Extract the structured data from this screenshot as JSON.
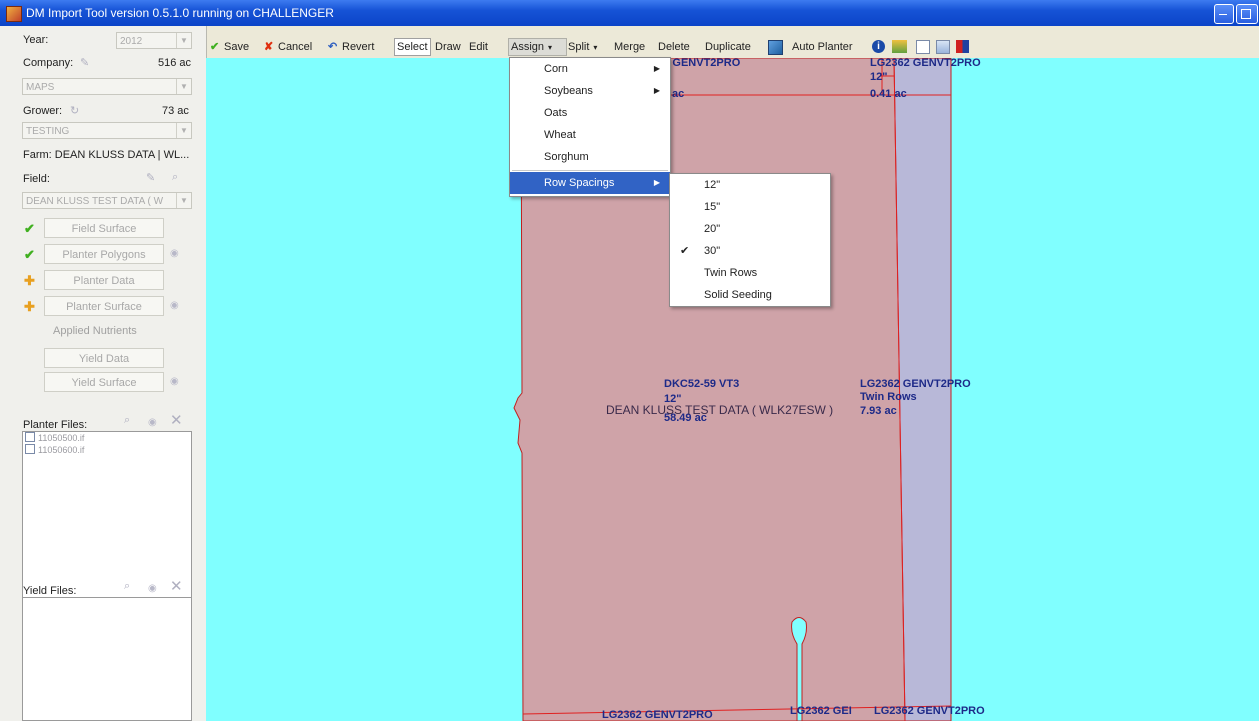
{
  "window": {
    "title": "DM Import Tool version 0.5.1.0 running on CHALLENGER"
  },
  "left": {
    "year_label": "Year:",
    "year_value": "2012",
    "company_label": "Company:",
    "company_acres": "516 ac",
    "company_value": "MAPS",
    "grower_label": "Grower:",
    "grower_acres": "73 ac",
    "grower_value": "TESTING",
    "farm_text": "Farm: DEAN KLUSS DATA | WL...",
    "field_label": "Field:",
    "field_value": "DEAN KLUSS TEST DATA ( W",
    "steps": [
      {
        "label": "Field Surface",
        "status": "check"
      },
      {
        "label": "Planter Polygons",
        "status": "check"
      },
      {
        "label": "Planter Data",
        "status": "plus"
      },
      {
        "label": "Planter Surface",
        "status": "plus"
      },
      {
        "label": "Applied Nutrients",
        "status": ""
      },
      {
        "label": "Yield Data",
        "status": ""
      },
      {
        "label": "Yield Surface",
        "status": ""
      }
    ],
    "planter_files_label": "Planter Files:",
    "planter_files": [
      "11050500.if",
      "11050600.if"
    ],
    "yield_files_label": "Yield Files:"
  },
  "toolbar": {
    "save": "Save",
    "cancel": "Cancel",
    "revert": "Revert",
    "select": "Select",
    "draw": "Draw",
    "edit": "Edit",
    "assign": "Assign",
    "split": "Split",
    "merge": "Merge",
    "delete": "Delete",
    "duplicate": "Duplicate",
    "auto_planter": "Auto Planter"
  },
  "assign_menu": {
    "items": [
      "Corn",
      "Soybeans",
      "Oats",
      "Wheat",
      "Sorghum",
      "Row Spacings"
    ]
  },
  "row_spacing_menu": {
    "items": [
      "12\"",
      "15\"",
      "20\"",
      "30\"",
      "Twin Rows",
      "Solid Seeding"
    ],
    "checked": "30\""
  },
  "map": {
    "field_name": "DEAN KLUSS TEST DATA ( WLK27ESW )",
    "labels": {
      "top_left": "362 GENVT2PRO",
      "top_left_acres": "ac",
      "top_right_hybrid": "LG2362 GENVT2PRO",
      "top_right_spacing": "12\"",
      "top_right_acres": "0.41 ac",
      "center_hybrid": "DKC52-59 VT3",
      "center_spacing": "12\"",
      "center_acres": "58.49 ac",
      "right_hybrid": "LG2362 GENVT2PRO",
      "right_spacing": "Twin Rows",
      "right_acres": "7.93 ac",
      "bottom_left": "LG2362 GENVT2PRO",
      "bottom_mid": "LG2362 GEI",
      "bottom_right": "LG2362 GENVT2PRO"
    }
  },
  "colors": {
    "map_background": "#80ffff",
    "field_fill": "#cfa3a8",
    "strip_fill": "#b8b8d8",
    "boundary": "#e02020",
    "menu_highlight": "#3163c5"
  }
}
